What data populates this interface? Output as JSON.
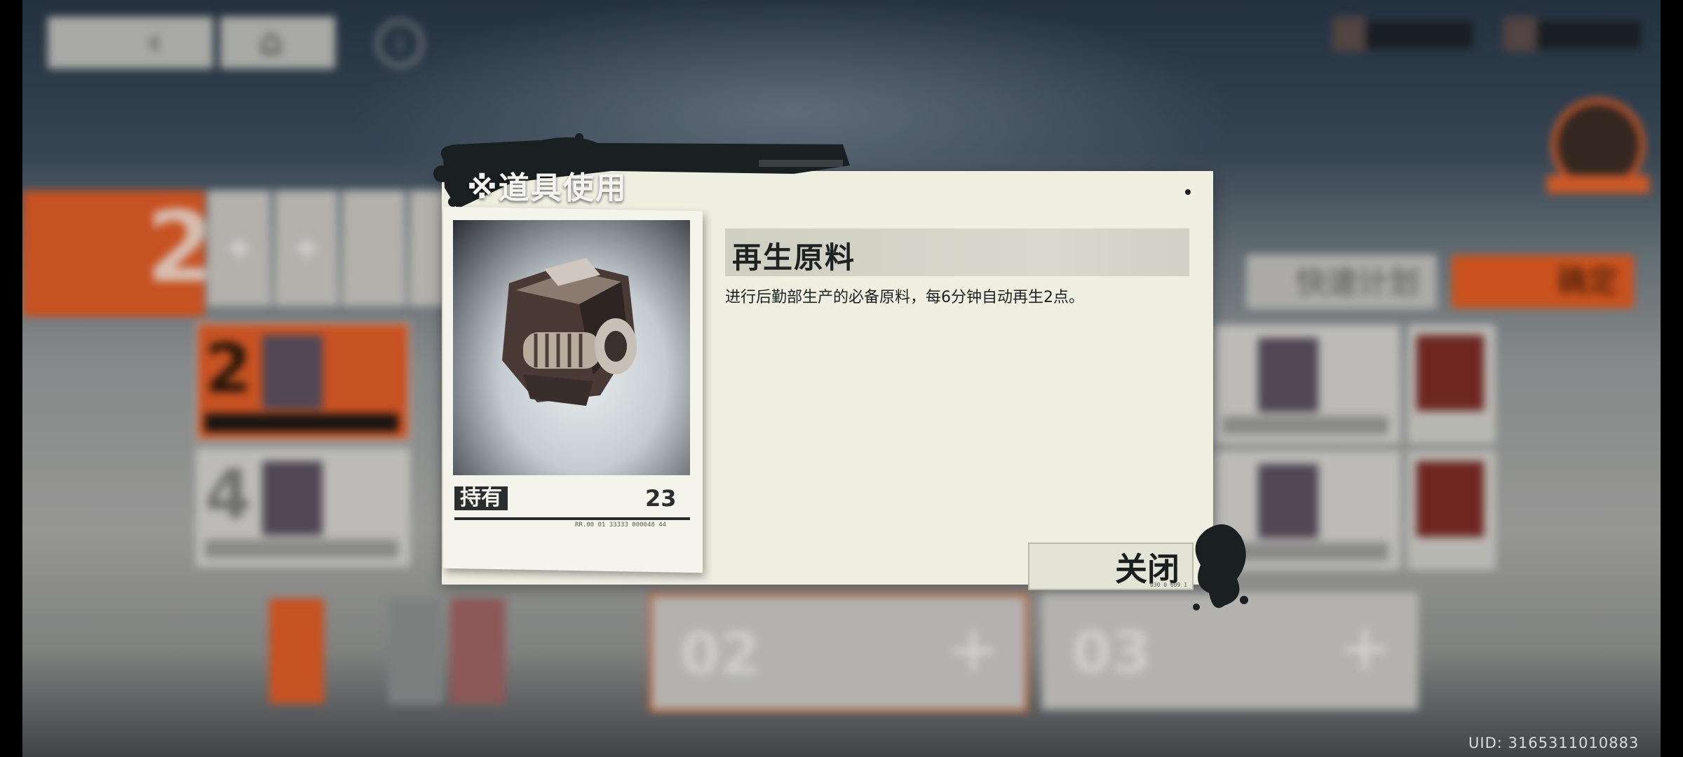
{
  "modal": {
    "title": "※道具使用",
    "item": {
      "name": "再生原料",
      "description": "进行后勤部生产的必备原料，每6分钟自动再生2点。",
      "hold_label": "持有",
      "hold_count": "23",
      "serial": "RR.00 01 33333 000048 44",
      "image_icon": "machine-part"
    },
    "close_label": "关闭",
    "close_serial": "030 0 609 1"
  },
  "background": {
    "quick_plan_label": "快速计划",
    "confirm_label": "确定",
    "top_left_number": "2",
    "rooms": [
      {
        "num": "2",
        "highlight": true
      },
      {
        "num": "4",
        "highlight": false
      }
    ],
    "shifts": [
      {
        "num": "02"
      },
      {
        "num": "03"
      }
    ],
    "resources": [
      "resource-1",
      "resource-2"
    ]
  },
  "footer": {
    "uid": "UID: 3165311010883"
  },
  "colors": {
    "accent_orange": "#e05a24",
    "modal_bg": "#eeeee1",
    "ink": "#1e2222"
  }
}
